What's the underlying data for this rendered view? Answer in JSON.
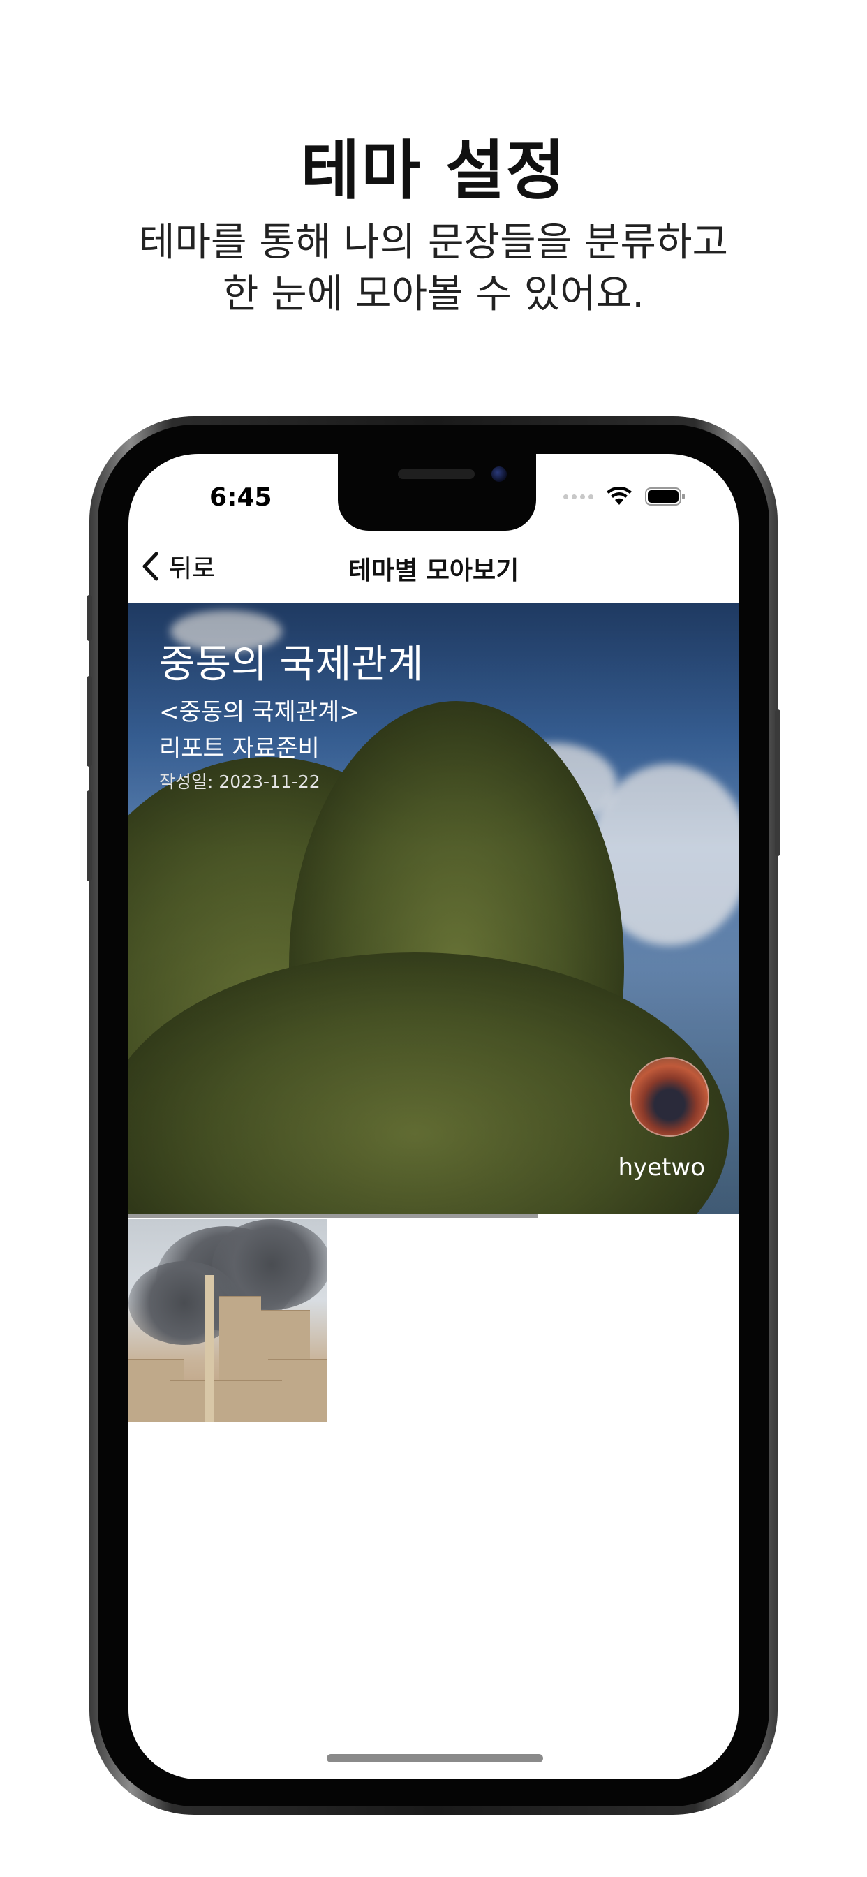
{
  "promo": {
    "title": "테마 설정",
    "subtitle_line1": "테마를 통해 나의 문장들을 분류하고",
    "subtitle_line2": "한 눈에 모아볼 수 있어요."
  },
  "status_bar": {
    "time": "6:45",
    "icons": [
      "signal-dots-icon",
      "wifi-icon",
      "battery-icon"
    ]
  },
  "nav": {
    "back_label": "뒤로",
    "back_icon": "chevron-left-icon",
    "title": "테마별 모아보기"
  },
  "theme": {
    "title": "중동의 국제관계",
    "subtitle": "<중동의 국제관계>",
    "description": "리포트 자료준비",
    "created": "작성일: 2023-11-22",
    "author": "hyetwo",
    "scroll_progress": 0.67
  },
  "entries": [
    {
      "image": "city-smoke-photo"
    }
  ]
}
